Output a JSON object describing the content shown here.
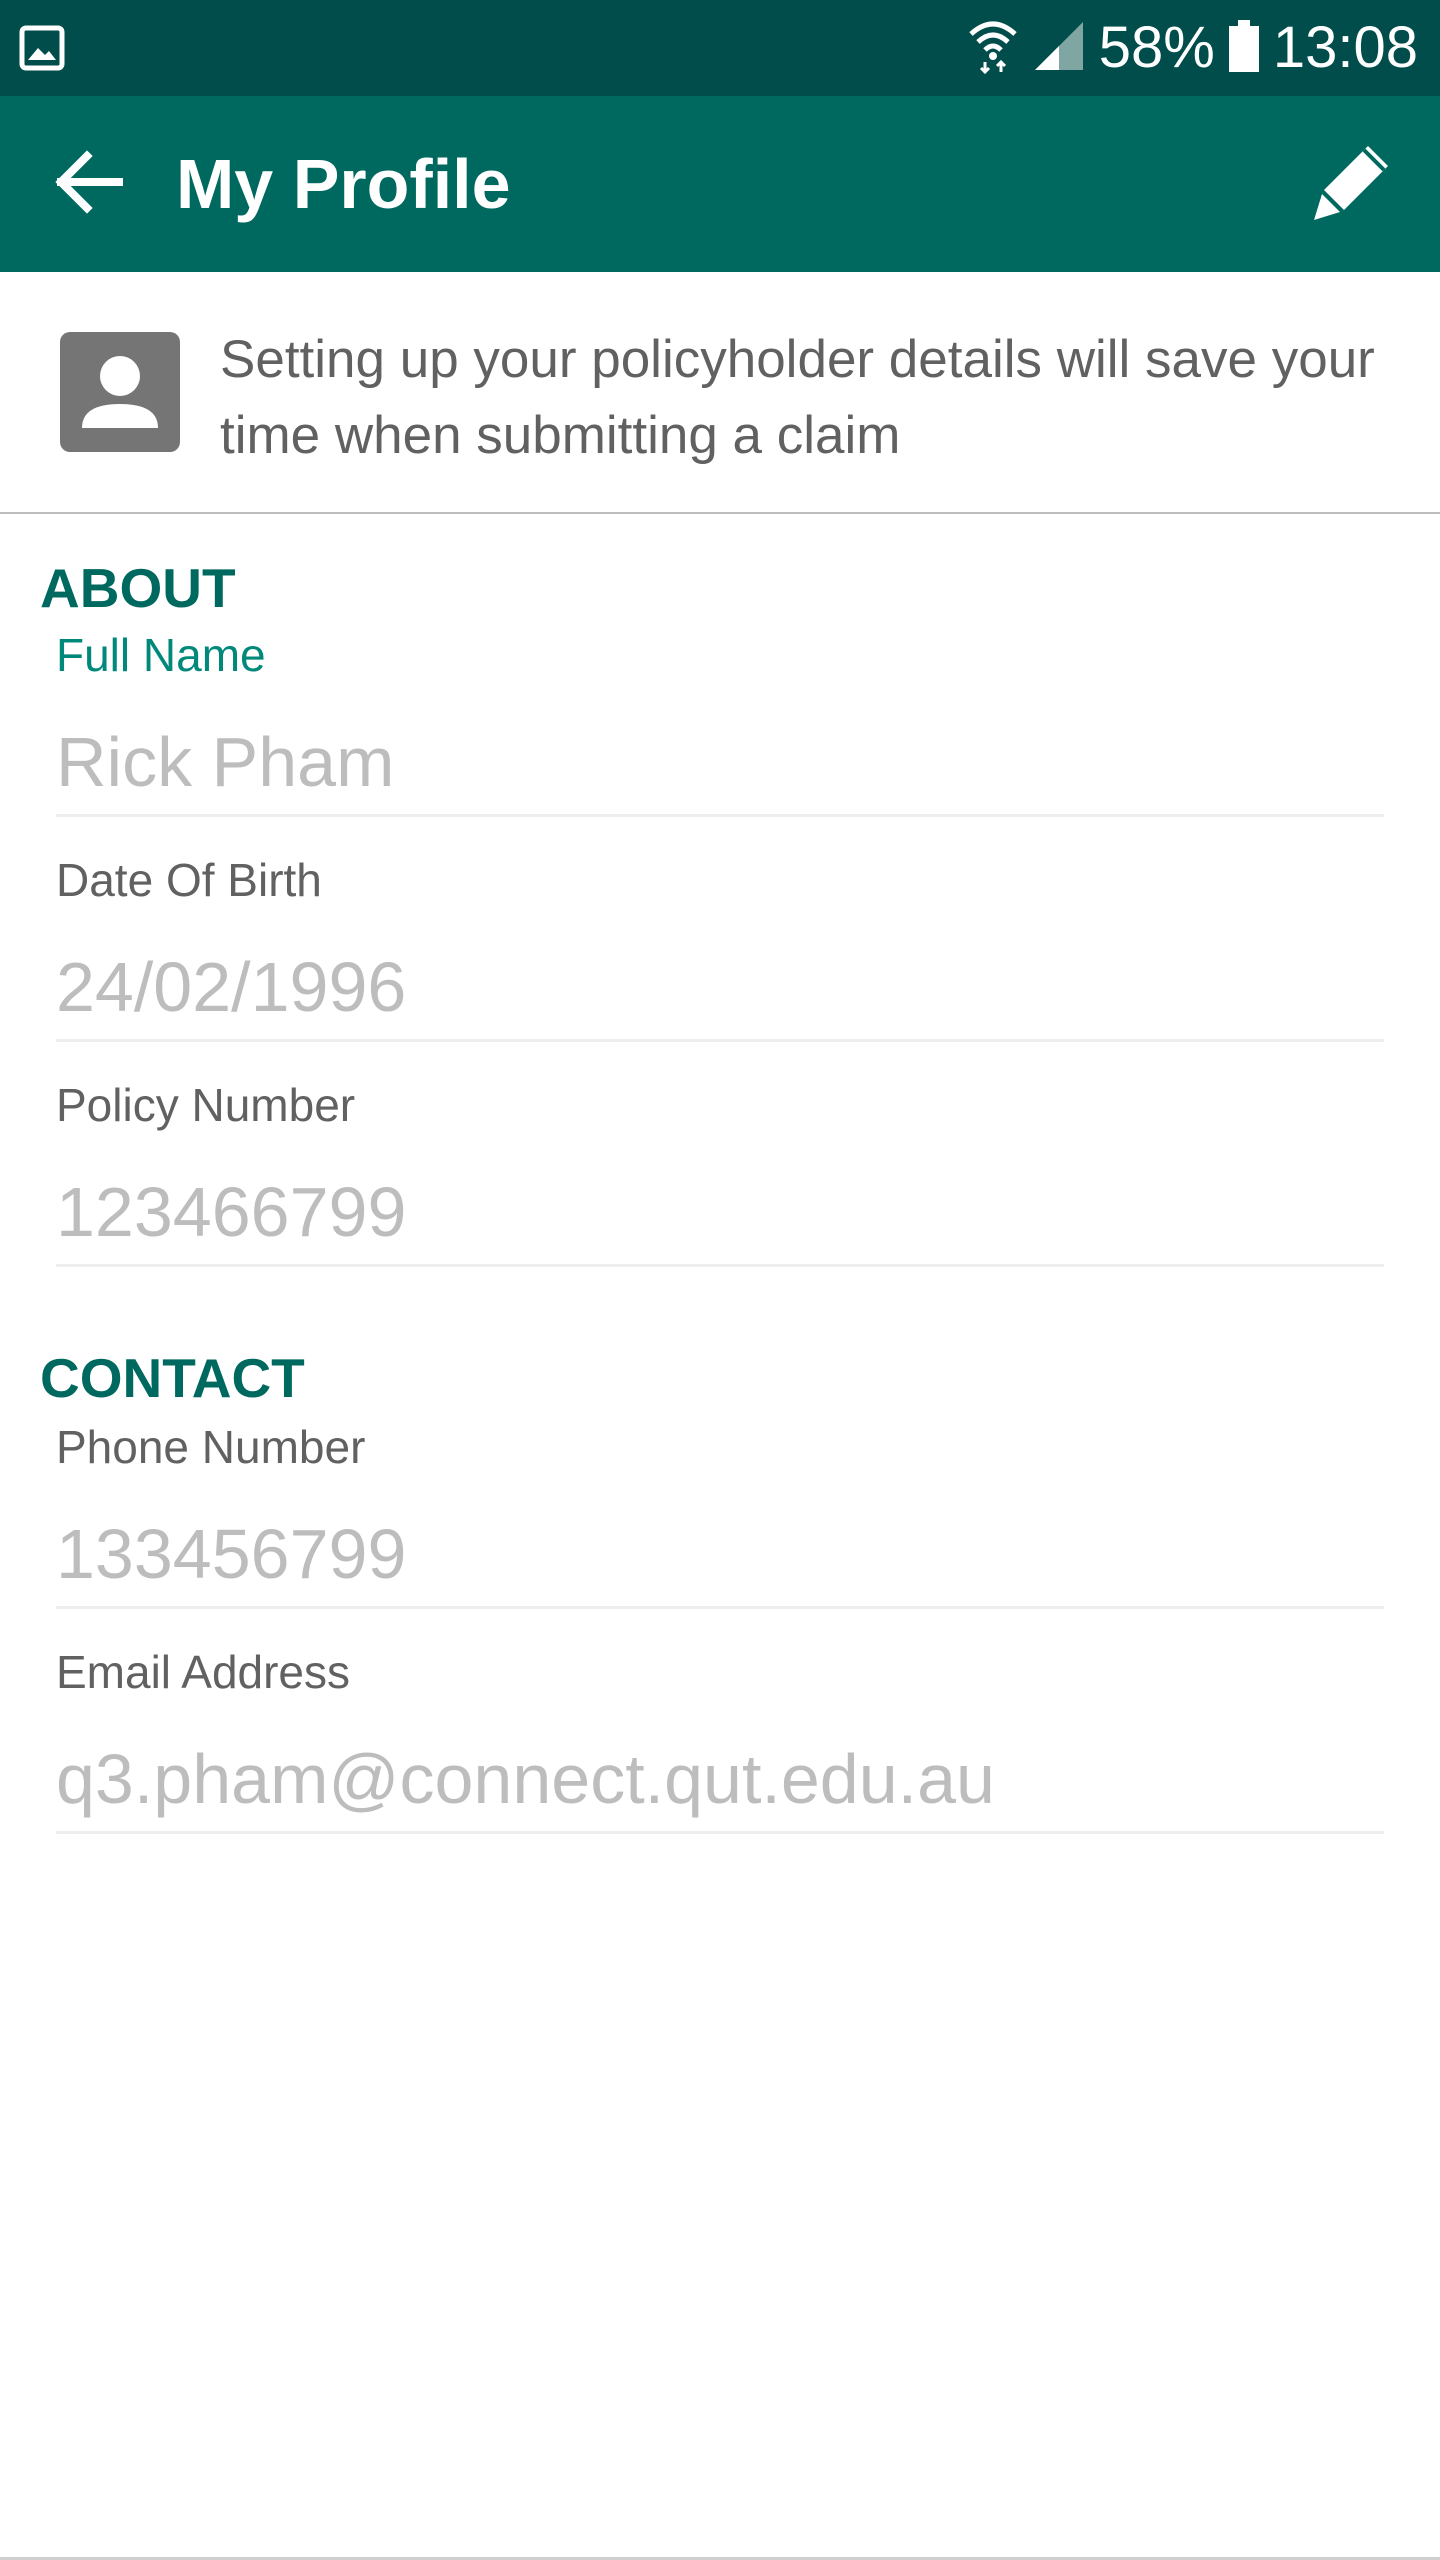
{
  "status_bar": {
    "battery": "58%",
    "time": "13:08"
  },
  "header": {
    "title": "My Profile"
  },
  "banner": {
    "text": "Setting up your policyholder details will save your time when submitting a claim"
  },
  "about": {
    "heading": "ABOUT",
    "full_name": {
      "label": "Full Name",
      "value": "Rick Pham"
    },
    "dob": {
      "label": "Date Of Birth",
      "value": "24/02/1996"
    },
    "policy": {
      "label": "Policy Number",
      "value": "123466799"
    }
  },
  "contact": {
    "heading": "CONTACT",
    "phone": {
      "label": "Phone Number",
      "value": "133456799"
    },
    "email": {
      "label": "Email Address",
      "value": "q3.pham@connect.qut.edu.au"
    }
  },
  "colors": {
    "status_bar": "#004d4b",
    "app_bar": "#00695f",
    "accent": "#00897b",
    "section_heading": "#00695f",
    "label": "#616161",
    "value": "#bdbdbd"
  },
  "icons": {
    "status_left": "gallery-icon",
    "wifi": "wifi-icon",
    "signal": "signal-icon",
    "battery": "battery-icon",
    "back": "arrow-back-icon",
    "edit": "pencil-icon",
    "avatar": "person-icon"
  }
}
